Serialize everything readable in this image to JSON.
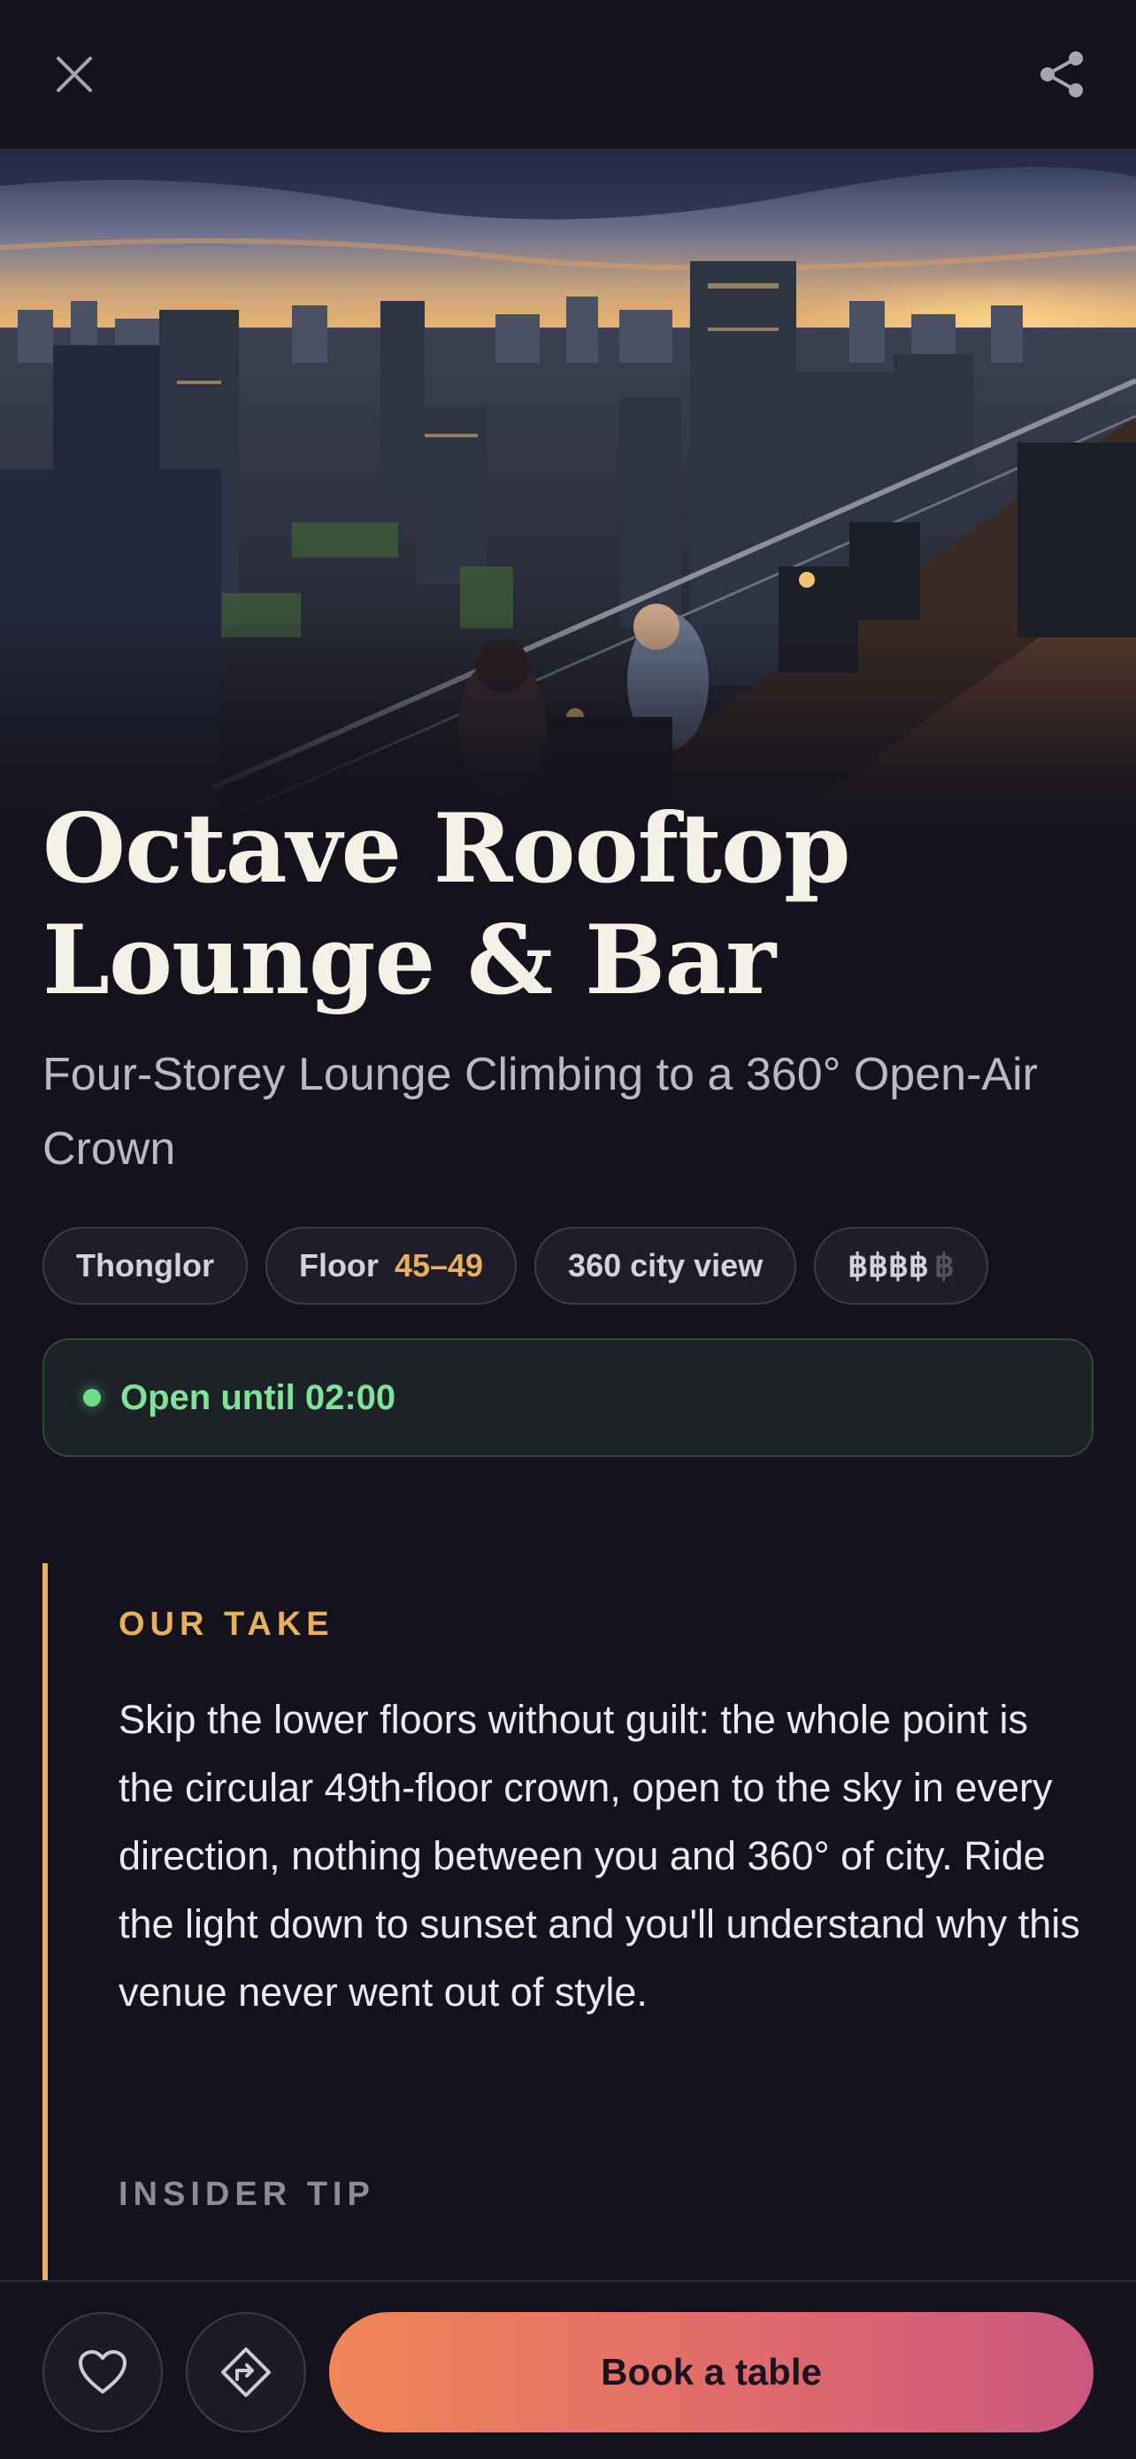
{
  "header": {
    "close_icon": "close-icon",
    "share_icon": "share-icon"
  },
  "hero": {
    "image": "city-skyline-rooftop-photo"
  },
  "venue": {
    "title": "Octave Rooftop Lounge & Bar",
    "subtitle": "Four-Storey Lounge Climbing to a 360° Open-Air Crown"
  },
  "chips": {
    "neighborhood": "Thonglor",
    "floor_label": "Floor",
    "floor_value": "45–49",
    "view": "360 city view",
    "price_active": "฿฿฿฿",
    "price_inactive": "฿",
    "price_level": 4,
    "price_max": 5
  },
  "status": {
    "text": "Open until 02:00",
    "color": "#6fdc8c"
  },
  "our_take": {
    "label": "OUR TAKE",
    "body": "Skip the lower floors without guilt: the whole point is the circular 49th-floor crown, open to the sky in every direction, nothing between you and 360° of city. Ride the light down to sunset and you'll understand why this venue never went out of style."
  },
  "insider_tip": {
    "label": "INSIDER TIP"
  },
  "actions": {
    "favorite_icon": "heart-icon",
    "directions_icon": "directions-icon",
    "book_label": "Book a table"
  },
  "colors": {
    "background": "#14131d",
    "accent": "#e8b05e",
    "cta_start": "#ef8656",
    "cta_end": "#cc577e"
  }
}
